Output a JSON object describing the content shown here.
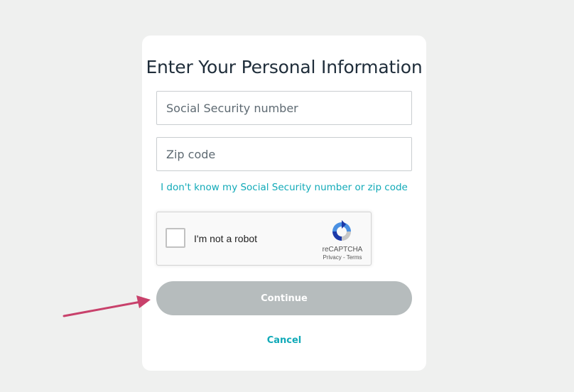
{
  "form": {
    "title": "Enter Your Personal Information",
    "ssn_placeholder": "Social Security number",
    "zip_placeholder": "Zip code",
    "help_link": "I don't know my Social Security number or zip code",
    "continue_label": "Continue",
    "cancel_label": "Cancel"
  },
  "recaptcha": {
    "label": "I'm not a robot",
    "brand": "reCAPTCHA",
    "privacy": "Privacy",
    "separator": " - ",
    "terms": "Terms",
    "logo_icon": "recaptcha-logo-icon"
  },
  "annotation": {
    "arrow_icon": "arrow-right-icon",
    "arrow_color": "#c8416b"
  },
  "colors": {
    "background": "#eff0ef",
    "card": "#ffffff",
    "accent": "#11aab8",
    "button_disabled": "#b6bcbd",
    "title_text": "#1f2d3a"
  }
}
